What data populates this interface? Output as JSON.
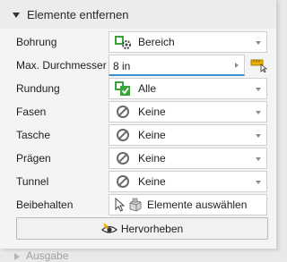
{
  "section": {
    "title": "Elemente entfernen"
  },
  "fields": [
    {
      "label": "Bohrung",
      "value": "Bereich",
      "icon": "hole-range-icon"
    },
    {
      "label": "Max. Durchmesser",
      "value": "8 in",
      "icon": "measure-icon"
    },
    {
      "label": "Rundung",
      "value": "Alle",
      "icon": "all-fillets-icon"
    },
    {
      "label": "Fasen",
      "value": "Keine",
      "icon": "none-icon"
    },
    {
      "label": "Tasche",
      "value": "Keine",
      "icon": "none-icon"
    },
    {
      "label": "Prägen",
      "value": "Keine",
      "icon": "none-icon"
    },
    {
      "label": "Tunnel",
      "value": "Keine",
      "icon": "none-icon"
    }
  ],
  "keep": {
    "label": "Beibehalten",
    "button_text": "Elemente auswählen"
  },
  "highlight_button": {
    "label": "Hervorheben"
  },
  "footer": {
    "label": "Ausgabe"
  },
  "colors": {
    "accent": "#3d8fd8",
    "icon_green": "#3aa43a",
    "measure_yellow": "#f0b400"
  }
}
